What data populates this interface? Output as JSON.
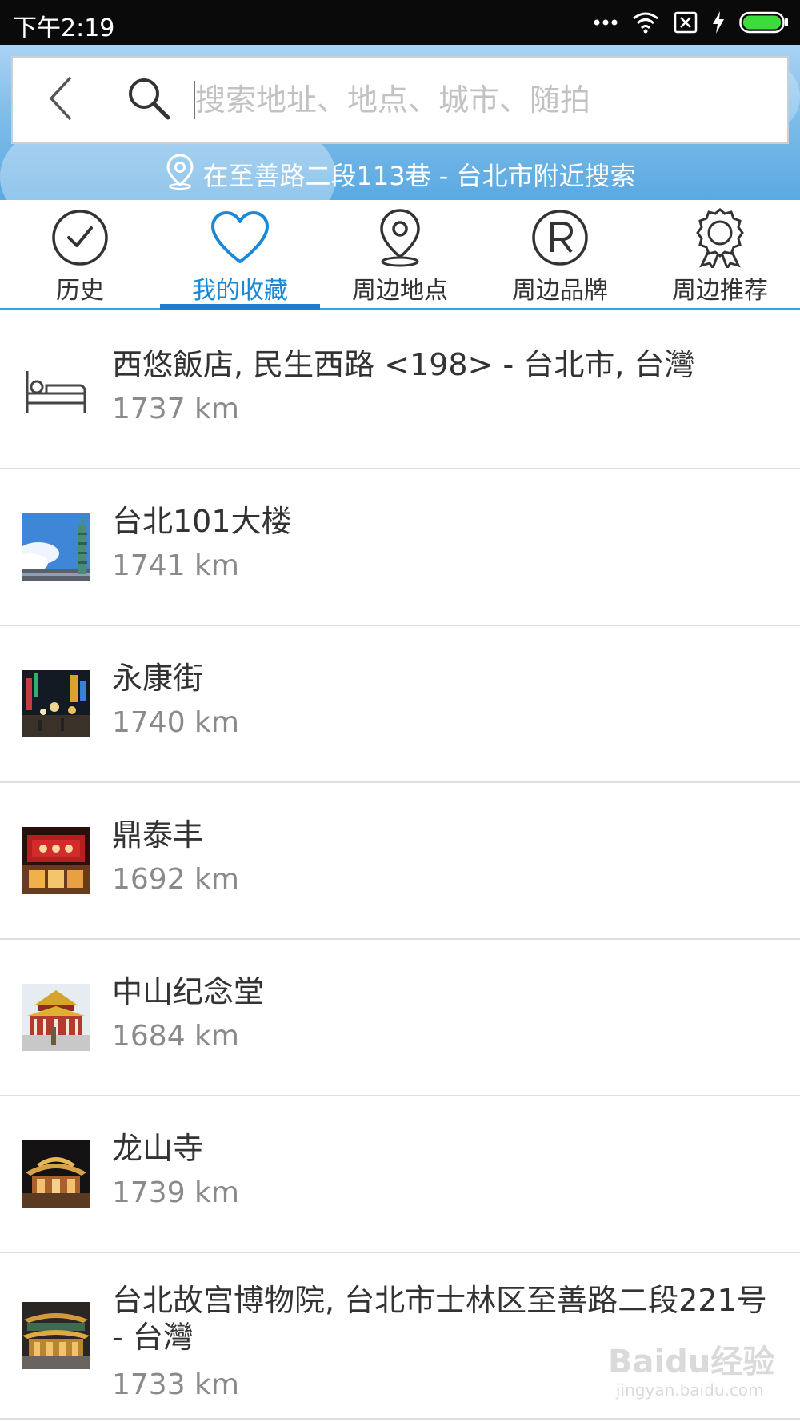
{
  "status_bar": {
    "time": "下午2:19"
  },
  "header": {
    "search_placeholder": "搜索地址、地点、城市、随拍",
    "nearby_text": "在至善路二段113巷 - 台北市附近搜索"
  },
  "tabs": [
    {
      "label": "历史",
      "icon": "clock-icon"
    },
    {
      "label": "我的收藏",
      "icon": "heart-icon",
      "active": true
    },
    {
      "label": "周边地点",
      "icon": "location-pin-icon"
    },
    {
      "label": "周边品牌",
      "icon": "registered-icon"
    },
    {
      "label": "周边推荐",
      "icon": "award-ribbon-icon"
    }
  ],
  "favorites": [
    {
      "title": "西悠飯店, 民生西路 <198> - 台北市, 台灣",
      "distance": "1737 km",
      "thumb": "hotel-bed-icon"
    },
    {
      "title": "台北101大楼",
      "distance": "1741 km",
      "thumb": "taipei-101-photo"
    },
    {
      "title": "永康街",
      "distance": "1740 km",
      "thumb": "yongkang-street-photo"
    },
    {
      "title": "鼎泰丰",
      "distance": "1692 km",
      "thumb": "din-tai-fung-photo"
    },
    {
      "title": "中山纪念堂",
      "distance": "1684 km",
      "thumb": "sun-yat-sen-memorial-photo"
    },
    {
      "title": "龙山寺",
      "distance": "1739 km",
      "thumb": "longshan-temple-photo"
    },
    {
      "title": "台北故宫博物院, 台北市士林区至善路二段221号 - 台灣",
      "distance": "1733 km",
      "thumb": "palace-museum-photo"
    }
  ],
  "watermark": {
    "text": "Baidu经验",
    "sub": "jingyan.baidu.com"
  },
  "colors": {
    "accent": "#1a88d8",
    "tab_underline": "#29a8f0",
    "status_bar": "#0a0a0a",
    "battery": "#3ddc3d"
  }
}
